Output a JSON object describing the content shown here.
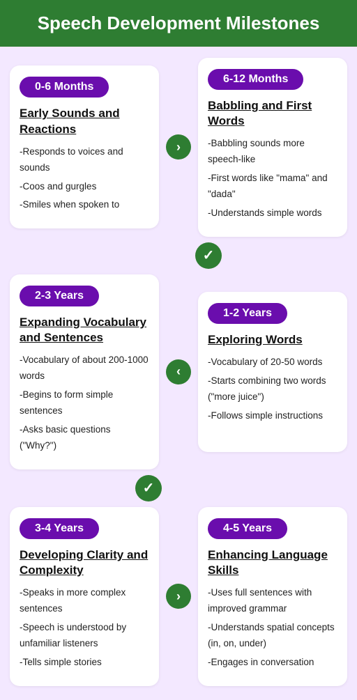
{
  "header": {
    "title": "Speech Development Milestones"
  },
  "sections": [
    {
      "id": "row1",
      "cards": [
        {
          "age": "0-6 Months",
          "title": "Early Sounds and Reactions",
          "bullets": [
            "-Responds to voices and sounds",
            "-Coos and gurgles",
            "-Smiles when spoken to"
          ]
        },
        {
          "age": "6-12 Months",
          "title": "Babbling and First Words",
          "bullets": [
            "-Babbling sounds more speech-like",
            "-First words like \"mama\" and \"dada\"",
            "-Understands simple words"
          ]
        }
      ],
      "arrow": {
        "direction": "right",
        "symbol": "›"
      }
    },
    {
      "id": "row2",
      "cards": [
        {
          "age": "2-3 Years",
          "title": "Expanding Vocabulary and Sentences",
          "bullets": [
            "-Vocabulary of about 200-1000 words",
            "-Begins to form simple sentences",
            "-Asks basic questions (\"Why?\")"
          ]
        },
        {
          "age": "1-2 Years",
          "title": "Exploring Words",
          "bullets": [
            "-Vocabulary of 20-50 words",
            "-Starts combining two words (\"more juice\")",
            "-Follows simple instructions"
          ]
        }
      ],
      "arrow": {
        "direction": "left",
        "symbol": "‹"
      }
    },
    {
      "id": "row3",
      "cards": [
        {
          "age": "3-4 Years",
          "title": "Developing Clarity and Complexity",
          "bullets": [
            "-Speaks in more complex sentences",
            "-Speech is understood by unfamiliar listeners",
            "-Tells simple stories"
          ]
        },
        {
          "age": "4-5 Years",
          "title": "Enhancing Language Skills",
          "bullets": [
            "-Uses full sentences with improved grammar",
            "-Understands spatial concepts (in, on, under)",
            "-Engages in conversation"
          ]
        }
      ],
      "arrow": {
        "direction": "right",
        "symbol": "›"
      }
    }
  ],
  "arrows": {
    "down_symbol": "✓",
    "right_symbol": "›",
    "left_symbol": "‹"
  }
}
